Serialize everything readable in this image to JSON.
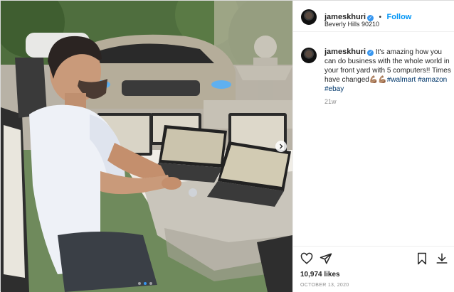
{
  "post": {
    "author": {
      "username": "jameskhuri",
      "verified_icon": "verified-badge-icon",
      "location": "Beverly Hills 90210",
      "follow_label": "Follow",
      "separator": "•"
    },
    "caption": {
      "username": "jameskhuri",
      "text_part1": "It's amazing how you can do business with the whole world in your front yard with 5 computers!! Times have changed",
      "emoji": "💪🏽💪🏽",
      "hashtags": [
        "#walmart",
        "#amazon",
        "#ebay"
      ],
      "time_ago": "21w"
    },
    "actions": {
      "like_icon": "heart-icon",
      "share_icon": "send-icon",
      "save_icon": "bookmark-icon",
      "download_icon": "download-icon"
    },
    "likes": "10,974 likes",
    "date": "OCTOBER 13, 2020",
    "carousel": {
      "total": 3,
      "active_index": 1,
      "next_icon": "chevron-right-icon"
    }
  },
  "colors": {
    "accent": "#0095f6",
    "verified": "#3897f0",
    "hashtag": "#00376b",
    "muted": "#8e8e8e"
  }
}
